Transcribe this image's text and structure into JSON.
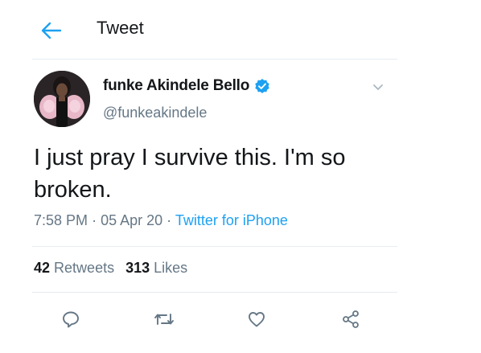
{
  "header": {
    "back_icon": "back-arrow-icon",
    "title": "Tweet"
  },
  "tweet": {
    "author": {
      "display_name": "funke Akindele Bello",
      "handle": "@funkeakindele",
      "verified": true,
      "avatar_icon": "user-avatar"
    },
    "text": "I just pray I survive this. I'm so broken.",
    "time": "7:58 PM",
    "date": "05 Apr 20",
    "separator": "·",
    "source": "Twitter for iPhone",
    "stats": {
      "retweets_count": "42",
      "retweets_label": "Retweets",
      "likes_count": "313",
      "likes_label": "Likes"
    },
    "actions": [
      {
        "icon": "reply-icon"
      },
      {
        "icon": "retweet-icon"
      },
      {
        "icon": "like-icon"
      },
      {
        "icon": "share-icon"
      }
    ]
  },
  "colors": {
    "accent": "#1da1f2",
    "text_primary": "#14171a",
    "text_secondary": "#657786",
    "divider": "#e6ecf0"
  }
}
